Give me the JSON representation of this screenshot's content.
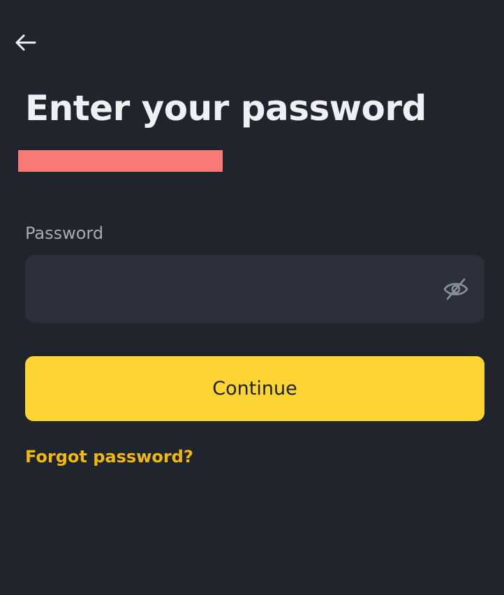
{
  "header": {
    "back_icon": "arrow-left-icon"
  },
  "main": {
    "title": "Enter your password",
    "redaction_color": "#f97a75",
    "password_label": "Password",
    "password_value": "",
    "eye_icon": "eye-off-icon",
    "continue_label": "Continue",
    "forgot_label": "Forgot password?"
  },
  "colors": {
    "background": "#20242d",
    "field": "#2b303b",
    "accent": "#fcd535",
    "link": "#f0b90b",
    "text": "#eef0f3",
    "muted": "#a6acb6"
  }
}
